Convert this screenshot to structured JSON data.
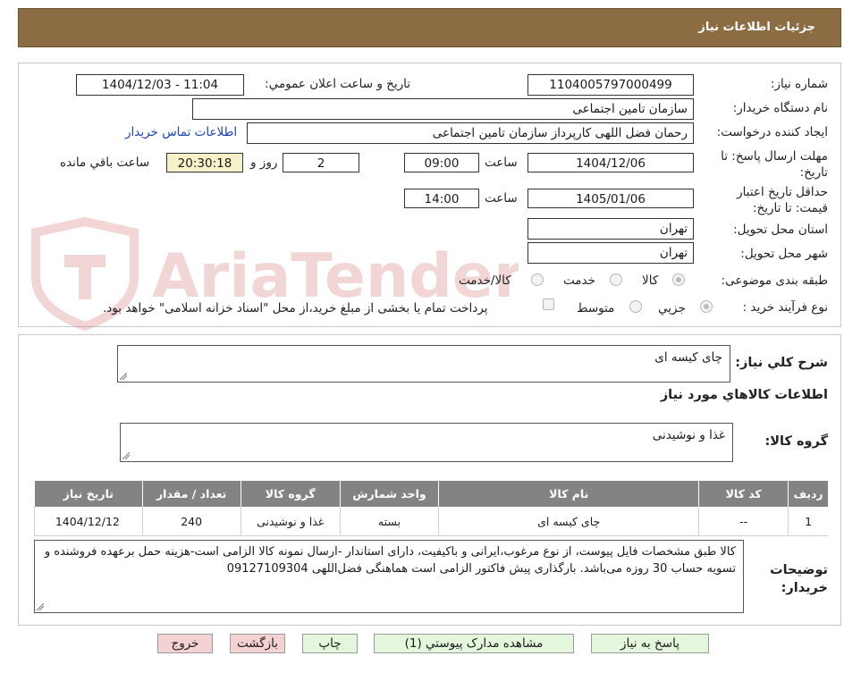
{
  "header": {
    "title": "جزئیات اطلاعات نیاز"
  },
  "form": {
    "need_number_label": "شماره نیاز:",
    "need_number": "1104005797000499",
    "announce_label": "تاریخ و ساعت اعلان عمومي:",
    "announce_value": "1404/12/03 - 11:04",
    "buyer_org_label": "نام دستگاه خریدار:",
    "buyer_org": "سازمان تامین اجتماعی",
    "creator_label": "ایجاد کننده درخواست:",
    "creator": "رحمان فضل اللهی کارپرداز سازمان تامین اجتماعی",
    "contact_link": "اطلاعات تماس خریدار",
    "deadline_label": "مهلت ارسال پاسخ: تا تاریخ:",
    "deadline_date": "1404/12/06",
    "time_label": "ساعت",
    "deadline_time": "09:00",
    "days_value": "2",
    "days_label": "روز و",
    "remaining_time": "20:30:18",
    "remaining_label": "ساعت باقي مانده",
    "validity_label": "حداقل تاریخ اعتبار قیمت: تا تاریخ:",
    "validity_date": "1405/01/06",
    "validity_time": "14:00",
    "province_label": "استان محل تحویل:",
    "province": "تهران",
    "city_label": "شهر محل تحویل:",
    "city": "تهران",
    "category_label": "طبقه بندی موضوعی:",
    "category_options": [
      "کالا",
      "خدمت",
      "کالا/خدمت"
    ],
    "process_label": "نوع فرآیند خرید :",
    "process_options": [
      "جزیي",
      "متوسط"
    ],
    "payment_note": "پرداخت تمام یا بخشی از مبلغ خرید،از محل \"اسناد خزانه اسلامی\" خواهد بود."
  },
  "details": {
    "summary_label": "شرح کلي نیاز:",
    "summary": "چای کیسه ای",
    "items_title": "اطلاعات کالاهاي مورد نیاز",
    "group_label": "گروه کالا:",
    "group": "غذا و نوشیدنی",
    "table": {
      "headers": [
        "ردیف",
        "کد کالا",
        "نام کالا",
        "واحد شمارش",
        "گروه کالا",
        "تعداد / مقدار",
        "تاریخ نیاز"
      ],
      "rows": [
        [
          "1",
          "--",
          "چای کیسه ای",
          "بسته",
          "غذا و نوشیدنی",
          "240",
          "1404/12/12"
        ]
      ]
    },
    "buyer_notes_label": "توضیحات خریدار:",
    "buyer_notes": "کالا طبق مشخصات فایل پیوست، از نوع مرغوب،ایرانی و باکیفیت، دارای استاندار -ارسال نمونه کالا الزامی است-هزینه حمل برعهده فروشنده و تسویه حساب 30 روزه می‌باشد. بارگذاری پیش فاکتور الزامی است هماهنگی فضل‌اللهی 09127109304"
  },
  "buttons": {
    "reply": "پاسخ به نیاز",
    "attachments": "مشاهده مدارک پیوستي (1)",
    "print": "چاپ",
    "back": "بازگشت",
    "exit": "خروج"
  },
  "watermark": {
    "text": "AriaTender.net"
  },
  "colors": {
    "header": "#8c6d43",
    "button_green": "#e4f7dc",
    "button_red": "#f5d2d2",
    "time_box": "#f6f1c9",
    "table_header": "#838383"
  }
}
